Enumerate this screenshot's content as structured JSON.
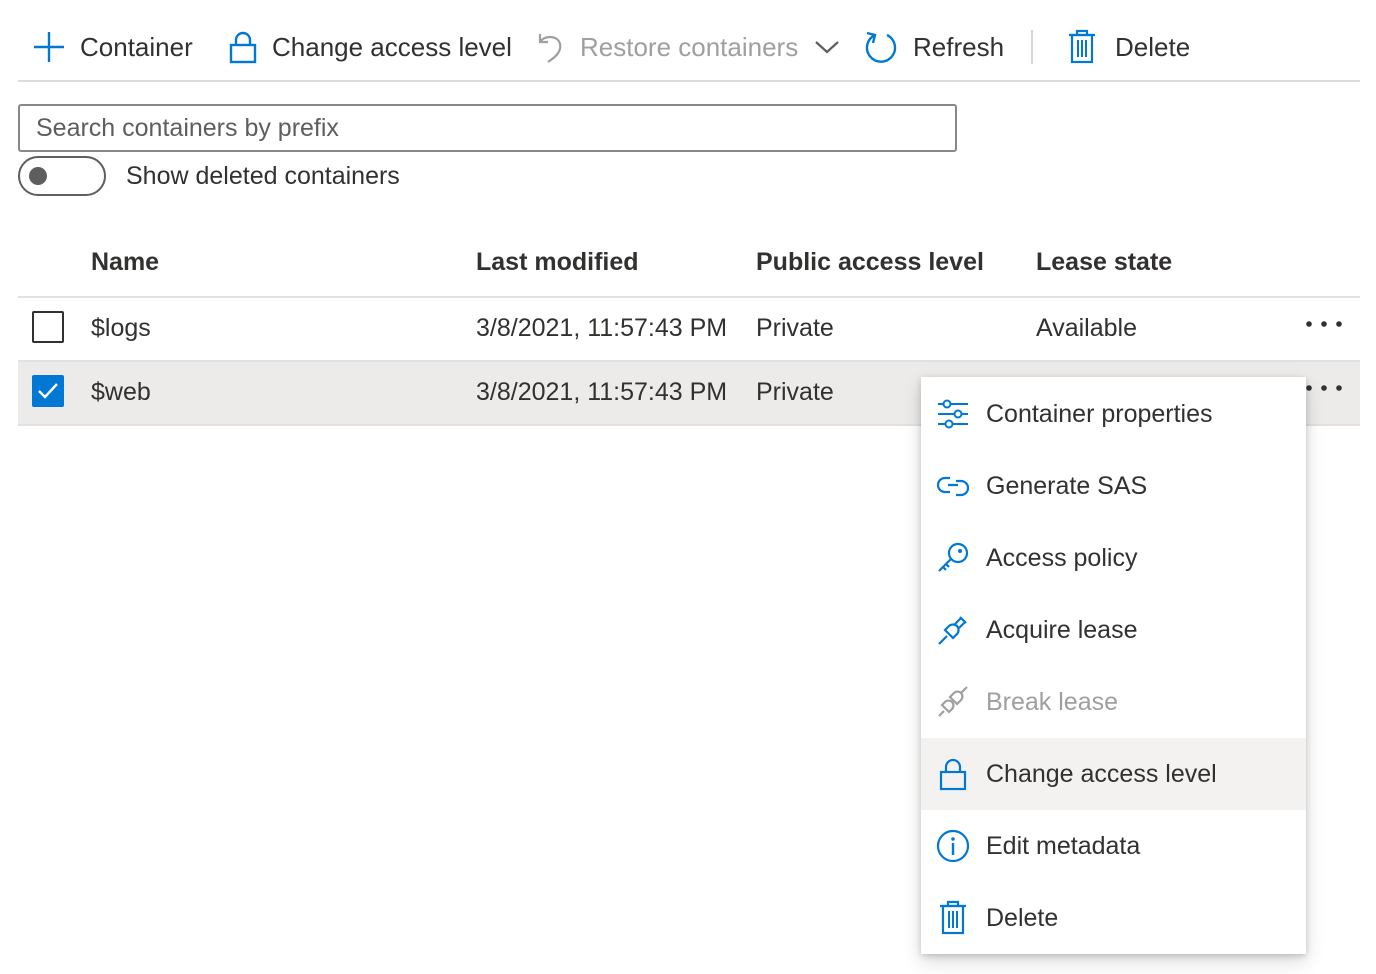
{
  "toolbar": {
    "container_label": "Container",
    "change_access_label": "Change access level",
    "restore_label": "Restore containers",
    "refresh_label": "Refresh",
    "delete_label": "Delete"
  },
  "search": {
    "placeholder": "Search containers by prefix",
    "value": ""
  },
  "toggle": {
    "label": "Show deleted containers",
    "on": false
  },
  "table": {
    "headers": [
      "Name",
      "Last modified",
      "Public access level",
      "Lease state"
    ],
    "rows": [
      {
        "name": "$logs",
        "last_modified": "3/8/2021, 11:57:43 PM",
        "access": "Private",
        "lease": "Available",
        "checked": false
      },
      {
        "name": "$web",
        "last_modified": "3/8/2021, 11:57:43 PM",
        "access": "Private",
        "lease": "",
        "checked": true
      }
    ]
  },
  "context_menu": {
    "items": [
      {
        "label": "Container properties",
        "icon": "sliders-icon"
      },
      {
        "label": "Generate SAS",
        "icon": "link-icon"
      },
      {
        "label": "Access policy",
        "icon": "key-icon"
      },
      {
        "label": "Acquire lease",
        "icon": "plug-icon"
      },
      {
        "label": "Break lease",
        "icon": "plug-disconnect-icon",
        "disabled": true
      },
      {
        "label": "Change access level",
        "icon": "lock-icon",
        "hovered": true
      },
      {
        "label": "Edit metadata",
        "icon": "info-icon"
      },
      {
        "label": "Delete",
        "icon": "trash-icon"
      }
    ]
  },
  "colors": {
    "accent": "#0078d4",
    "text": "#323130",
    "disabled": "#a19f9d",
    "selected_row": "#edebe9",
    "menu_hover": "#f3f2f1"
  }
}
